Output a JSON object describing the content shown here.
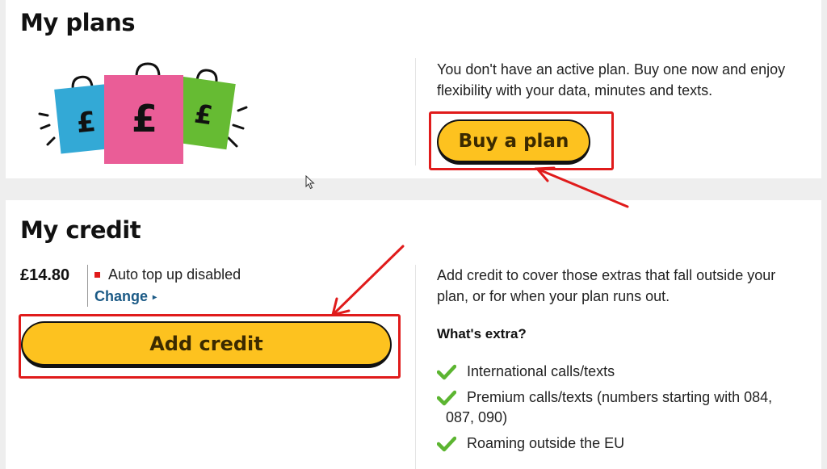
{
  "plans": {
    "heading": "My plans",
    "description": "You don't have an active plan. Buy one now and enjoy flexibility with your data, minutes and texts.",
    "buy_button": "Buy a plan",
    "illustration_bags": [
      "£",
      "£",
      "£"
    ]
  },
  "credit": {
    "heading": "My credit",
    "balance": "£14.80",
    "topup_status": "Auto top up disabled",
    "change_link": "Change",
    "add_button": "Add credit",
    "description": "Add credit to cover those extras that fall outside your plan, or for when your plan runs out.",
    "extras_heading": "What's extra?",
    "extras": [
      {
        "line1": "International calls/texts",
        "line2": ""
      },
      {
        "line1": "Premium calls/texts (numbers starting with 084,",
        "line2": "087, 090)"
      },
      {
        "line1": "Roaming outside the EU",
        "line2": ""
      }
    ]
  },
  "colors": {
    "button_yellow": "#fdc21f",
    "highlight_red": "#e01b1b",
    "link_blue": "#1b5a86",
    "check_green": "#5cb531"
  },
  "icons": [
    "shopping-bags-illustration",
    "check-icon",
    "red-status-square",
    "triangle-right-icon",
    "mouse-cursor-icon",
    "annotation-arrow"
  ]
}
